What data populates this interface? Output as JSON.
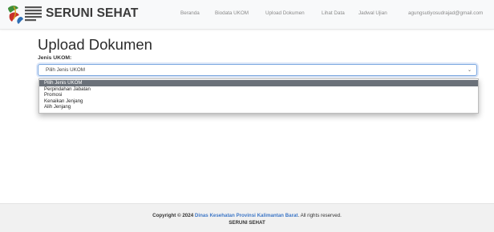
{
  "app": {
    "brand": "SERUNI SEHAT",
    "logo_text": [
      "DINAS",
      "KESEHATAN",
      "PROVINSI",
      "KALIMANTAN",
      "BARAT"
    ]
  },
  "nav": {
    "items": [
      "Beranda",
      "Biodata UKOM",
      "Upload Dokumen",
      "Lihat Data",
      "Jadwal Ujian",
      "agungsutiyosudrajad@gmail.com"
    ]
  },
  "page": {
    "title": "Upload Dokumen",
    "field_label": "Jenis UKOM:"
  },
  "select": {
    "value": "Pilih Jenis UKOM",
    "options": [
      "Pilih Jenis UKOM",
      "Perpindahan Jabatan",
      "Promosi",
      "Kenaikan Jenjang",
      "Alih Jenjang"
    ],
    "selected_index": 0
  },
  "footer": {
    "copyright_prefix": "Copyright © 2024",
    "org_link": "Dinas Kesehatan Provinsi Kalimantan Barat",
    "rights": ". All rights reserved.",
    "app_name": "SERUNI SEHAT"
  },
  "colors": {
    "accent": "#3f78c7",
    "logo_green": "#3f8f3a",
    "logo_red": "#c8302a",
    "selected_option": "#6b7179"
  }
}
